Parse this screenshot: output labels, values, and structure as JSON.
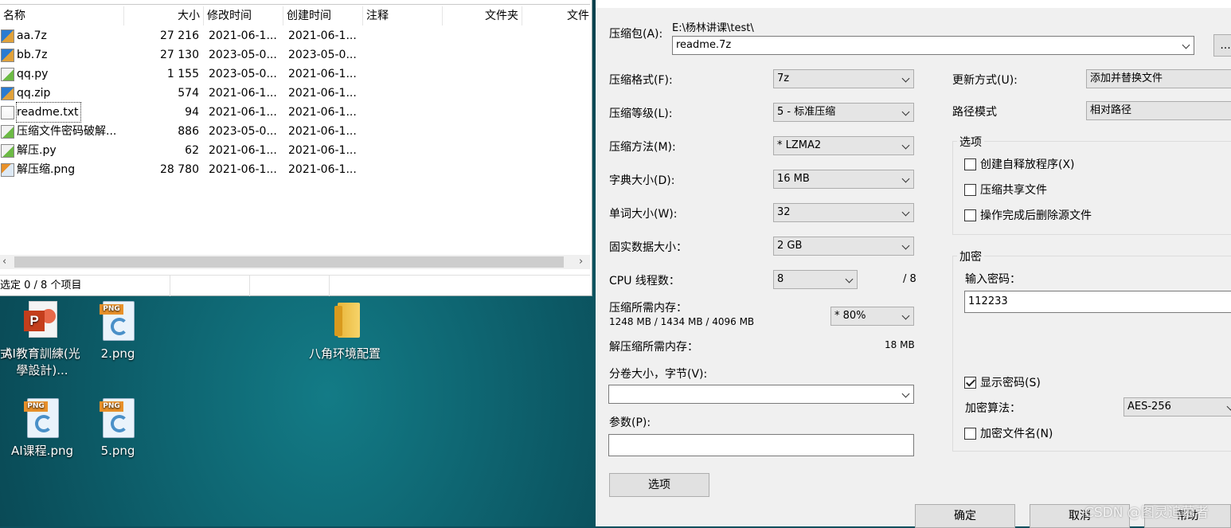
{
  "explorer": {
    "columns": [
      "名称",
      "大小",
      "修改时间",
      "创建时间",
      "注释",
      "文件夹",
      "文件"
    ],
    "files": [
      {
        "name": "aa.7z",
        "size": "27 216",
        "modified": "2021-06-1...",
        "created": "2021-06-1...",
        "icon": "archive-icon"
      },
      {
        "name": "bb.7z",
        "size": "27 130",
        "modified": "2023-05-0...",
        "created": "2023-05-0...",
        "icon": "archive-icon"
      },
      {
        "name": "qq.py",
        "size": "1 155",
        "modified": "2023-05-0...",
        "created": "2021-06-1...",
        "icon": "python-file-icon"
      },
      {
        "name": "qq.zip",
        "size": "574",
        "modified": "2021-06-1...",
        "created": "2021-06-1...",
        "icon": "archive-icon"
      },
      {
        "name": "readme.txt",
        "size": "94",
        "modified": "2021-06-1...",
        "created": "2021-06-1...",
        "icon": "text-file-icon"
      },
      {
        "name": "压缩文件密码破解...",
        "size": "886",
        "modified": "2023-05-0...",
        "created": "2021-06-1...",
        "icon": "python-file-icon"
      },
      {
        "name": "解压.py",
        "size": "62",
        "modified": "2021-06-1...",
        "created": "2021-06-1...",
        "icon": "python-file-icon"
      },
      {
        "name": "解压缩.png",
        "size": "28 780",
        "modified": "2021-06-1...",
        "created": "2021-06-1...",
        "icon": "image-file-icon"
      }
    ],
    "status": "选定 0 / 8 个项目"
  },
  "desktop": {
    "icons": [
      {
        "label": "AI教育訓練(光學設計)...",
        "type": "powerpoint-icon"
      },
      {
        "label": "2.png",
        "type": "png-icon"
      },
      {
        "label": "八角环境配置",
        "type": "folder-icon"
      },
      {
        "label": "AI课程.png",
        "type": "png-icon"
      },
      {
        "label": "5.png",
        "type": "png-icon"
      }
    ],
    "edge_char": "式"
  },
  "dialog": {
    "archive_label": "压缩包(A):",
    "archive_path": "E:\\杨林讲课\\test\\",
    "archive_name": "readme.7z",
    "browse_label": "...",
    "format_label": "压缩格式(F):",
    "format_value": "7z",
    "level_label": "压缩等级(L):",
    "level_value": "5 - 标准压缩",
    "method_label": "压缩方法(M):",
    "method_value": "* LZMA2",
    "dict_label": "字典大小(D):",
    "dict_value": "16 MB",
    "word_label": "单词大小(W):",
    "word_value": "32",
    "solid_label": "固实数据大小：",
    "solid_value": "2 GB",
    "cpu_label": "CPU 线程数：",
    "cpu_value": "8",
    "cpu_max": "/ 8",
    "mem_label": "压缩所需内存：",
    "mem_value": "1248 MB / 1434 MB / 4096 MB",
    "mem_percent": "* 80%",
    "decomp_label": "解压缩所需内存：",
    "decomp_value": "18 MB",
    "volume_label": "分卷大小，字节(V):",
    "volume_value": "",
    "params_label": "参数(P):",
    "params_value": "",
    "options_button": "选项",
    "update_label": "更新方式(U):",
    "update_value": "添加并替换文件",
    "path_label": "路径模式",
    "path_value": "相对路径",
    "options_group": "选项",
    "opt_sfx": "创建自释放程序(X)",
    "opt_shared": "压缩共享文件",
    "opt_delete": "操作完成后删除源文件",
    "encrypt_group": "加密",
    "password_label": "输入密码：",
    "password_value": "112233",
    "show_password": "显示密码(S)",
    "enc_method_label": "加密算法：",
    "enc_method_value": "AES-256",
    "encrypt_names": "加密文件名(N)",
    "ok_button": "确定",
    "cancel_button": "取消",
    "help_button": "帮助"
  },
  "watermark": "CSDN @图灵追慕者"
}
